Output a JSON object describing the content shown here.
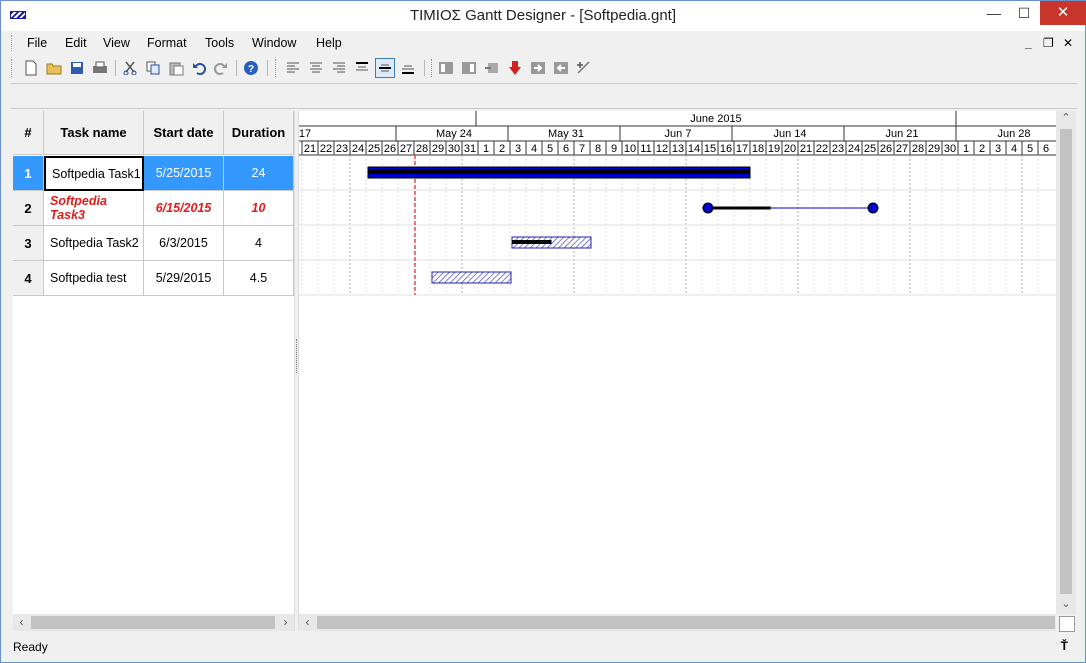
{
  "window": {
    "title": "TIMIOΣ Gantt Designer - [Softpedia.gnt]",
    "controls": {
      "minimize": "—",
      "maximize": "☐",
      "close": "✕"
    }
  },
  "menu": {
    "items": [
      "File",
      "Edit",
      "View",
      "Format",
      "Tools",
      "Window",
      "Help"
    ],
    "mdi_controls": {
      "minimize": "_",
      "restore": "❐",
      "close": "✕"
    }
  },
  "toolbar": {
    "buttons": [
      {
        "icon": "new-file-icon"
      },
      {
        "icon": "open-folder-icon"
      },
      {
        "icon": "save-icon"
      },
      {
        "icon": "print-icon"
      },
      {
        "icon": "cut-icon"
      },
      {
        "icon": "copy-icon"
      },
      {
        "icon": "paste-icon"
      },
      {
        "icon": "undo-icon"
      },
      {
        "icon": "redo-icon"
      },
      {
        "icon": "help-icon"
      },
      {
        "icon": "align-left-icon"
      },
      {
        "icon": "align-center-icon"
      },
      {
        "icon": "align-right-icon"
      },
      {
        "icon": "align-top-icon"
      },
      {
        "icon": "align-middle-icon",
        "pressed": true
      },
      {
        "icon": "align-bottom-icon"
      },
      {
        "icon": "task-indent-icon"
      },
      {
        "icon": "task-outdent-icon"
      },
      {
        "icon": "delete-link-icon"
      },
      {
        "icon": "milestone-icon"
      },
      {
        "icon": "arrow-right-icon"
      },
      {
        "icon": "arrow-left-icon"
      },
      {
        "icon": "link-tasks-icon"
      }
    ]
  },
  "grid": {
    "headers": {
      "num": "#",
      "name": "Task name",
      "start": "Start date",
      "duration": "Duration"
    },
    "rows": [
      {
        "num": "1",
        "name": "Softpedia Task1",
        "start": "5/25/2015",
        "duration": "24",
        "selected": true
      },
      {
        "num": "2",
        "name": "Softpedia Task3",
        "start": "6/15/2015",
        "duration": "10",
        "color": "#e01b1b",
        "italic": true
      },
      {
        "num": "3",
        "name": "Softpedia Task2",
        "start": "6/3/2015",
        "duration": "4"
      },
      {
        "num": "4",
        "name": "Softpedia test",
        "start": "5/29/2015",
        "duration": "4.5"
      }
    ]
  },
  "chart": {
    "month_label": "June 2015",
    "week_labels": [
      "17",
      "May 24",
      "May 31",
      "Jun 7",
      "Jun 14",
      "Jun 21",
      "Jun 28"
    ],
    "day_labels": [
      "21",
      "22",
      "23",
      "24",
      "25",
      "26",
      "27",
      "28",
      "29",
      "30",
      "31",
      "1",
      "2",
      "3",
      "4",
      "5",
      "6",
      "7",
      "8",
      "9",
      "10",
      "11",
      "12",
      "13",
      "14",
      "15",
      "16",
      "17",
      "18",
      "19",
      "20",
      "21",
      "22",
      "23",
      "24",
      "25",
      "26",
      "27",
      "28",
      "29",
      "30",
      "1",
      "2",
      "3",
      "4",
      "5",
      "6"
    ],
    "today_line_color": "#cc0000",
    "bar_color": "#0000cc",
    "bars": [
      {
        "row": 1,
        "start": "5/25/2015",
        "end": "6/17/2015",
        "type": "solid",
        "progress": 1.0
      },
      {
        "row": 2,
        "start": "6/15/2015",
        "end": "6/26/2015",
        "type": "milestone-line",
        "progress": 0.38
      },
      {
        "row": 3,
        "start": "6/3/2015",
        "end": "6/8/2015",
        "type": "hatched",
        "progress": 0.5
      },
      {
        "row": 4,
        "start": "5/29/2015",
        "end": "6/3/2015",
        "type": "hatched",
        "progress": 0
      }
    ]
  },
  "status": {
    "text": "Ready"
  }
}
